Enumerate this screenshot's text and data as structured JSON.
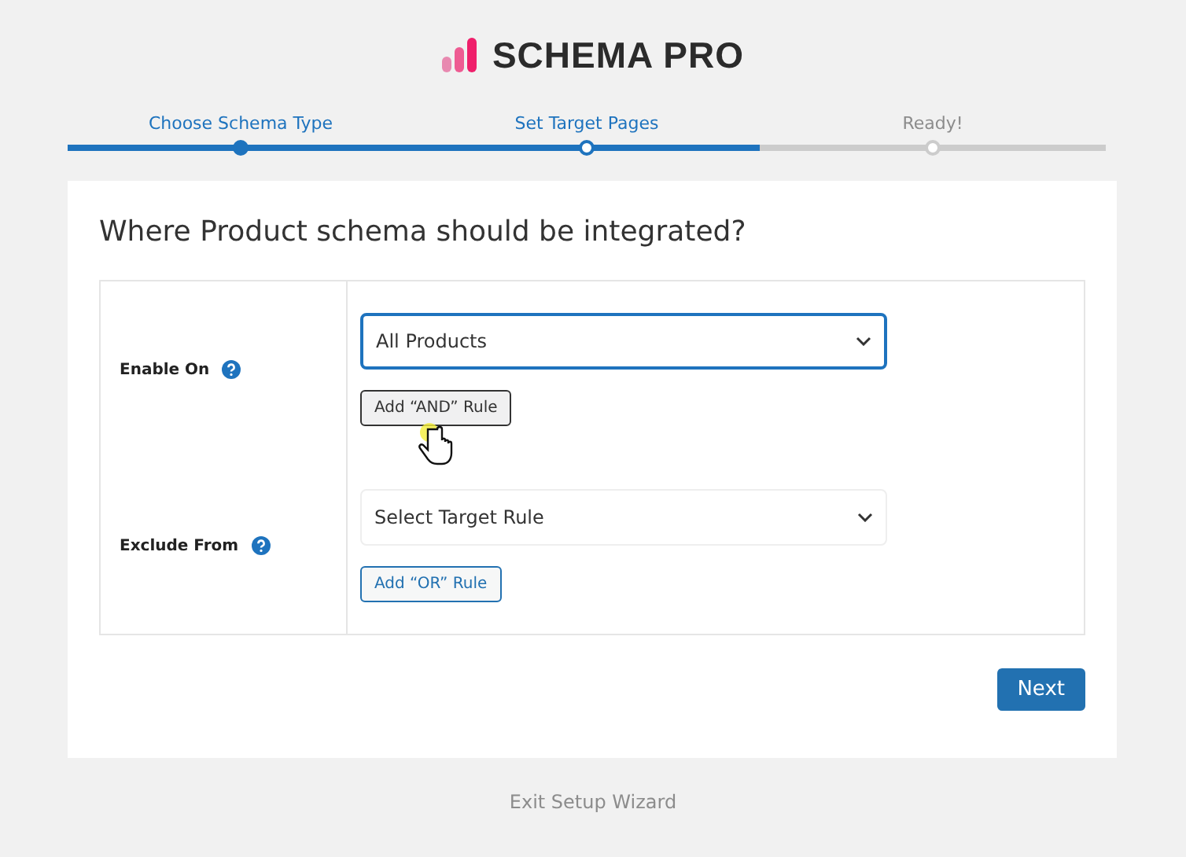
{
  "logo": {
    "title": "SCHEMA PRO"
  },
  "steps": [
    {
      "label": "Choose Schema Type",
      "kind": "done"
    },
    {
      "label": "Set Target Pages",
      "kind": "current"
    },
    {
      "label": "Ready!",
      "kind": "todo"
    }
  ],
  "card": {
    "title": "Where Product schema should be integrated?",
    "rows": [
      {
        "label": "Enable On",
        "select": {
          "value": "All Products",
          "focused": true
        },
        "button": "Add “AND” Rule"
      },
      {
        "label": "Exclude From",
        "select": {
          "placeholder": "Select Target Rule",
          "focused": false
        },
        "button": "Add “OR” Rule"
      }
    ],
    "next_button": "Next"
  },
  "exit_link": "Exit Setup Wizard"
}
